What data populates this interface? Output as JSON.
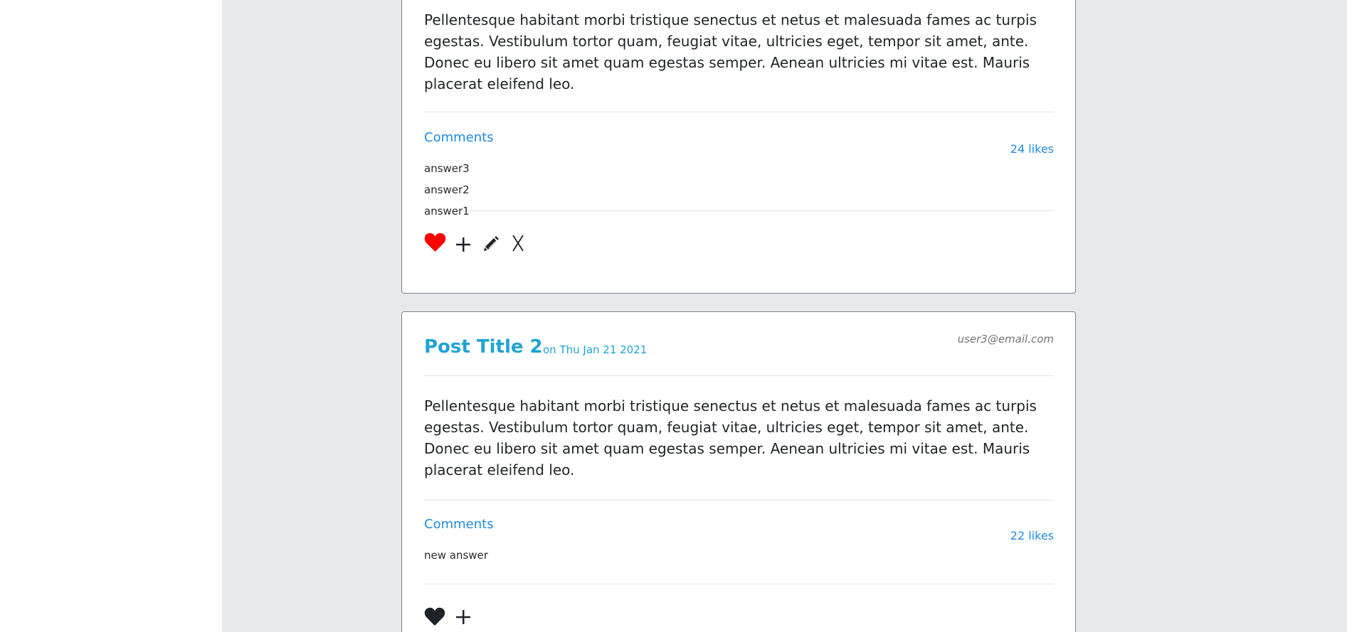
{
  "posts": [
    {
      "title": "",
      "date": "",
      "author": "",
      "body": "Pellentesque habitant morbi tristique senectus et netus et malesuada fames ac turpis egestas. Vestibulum tortor quam, feugiat vitae, ultricies eget, tempor sit amet, ante. Donec eu libero sit amet quam egestas semper. Aenean ultricies mi vitae est. Mauris placerat eleifend leo.",
      "comments_label": "Comments",
      "likes": "24 likes",
      "answers": [
        "answer3",
        "answer2",
        "answer1"
      ],
      "liked": true,
      "actions": [
        "heart-icon",
        "plus-icon",
        "pencil-icon",
        "x-icon"
      ],
      "x_label": "X"
    },
    {
      "title": "Post Title 2",
      "date": "on Thu Jan 21 2021",
      "author": "user3@email.com",
      "body": "Pellentesque habitant morbi tristique senectus et netus et malesuada fames ac turpis egestas. Vestibulum tortor quam, feugiat vitae, ultricies eget, tempor sit amet, ante. Donec eu libero sit amet quam egestas semper. Aenean ultricies mi vitae est. Mauris placerat eleifend leo.",
      "comments_label": "Comments",
      "likes": "22 likes",
      "answers": [
        "new answer"
      ],
      "liked": false,
      "actions": [
        "heart-icon",
        "plus-icon"
      ]
    }
  ],
  "colors": {
    "title": "#1fa3d4",
    "link": "#1f8be0",
    "liked_heart": "#ff0000",
    "unliked_heart": "#1f2329",
    "background": "#e8e9ec"
  }
}
